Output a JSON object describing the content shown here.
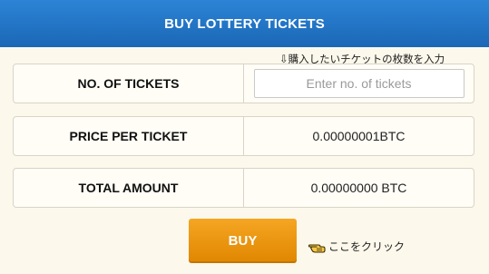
{
  "header": {
    "title": "BUY LOTTERY TICKETS"
  },
  "hint_top": {
    "text": "⇩購入したいチケットの枚数を入力"
  },
  "rows": {
    "tickets": {
      "label": "NO. OF TICKETS",
      "input_value": "",
      "input_placeholder": "Enter no. of tickets"
    },
    "price": {
      "label": "PRICE PER TICKET",
      "value": "0.00000001BTC"
    },
    "total": {
      "label": "TOTAL AMOUNT",
      "value": "0.00000000 BTC"
    }
  },
  "buy_button": {
    "label": "BUY"
  },
  "hint_bottom": {
    "icon": "pointing-hand-icon",
    "text": "ここをクリック"
  },
  "colors": {
    "header_blue": "#1b67b6",
    "button_orange": "#e08600",
    "background": "#fcf8ec"
  }
}
